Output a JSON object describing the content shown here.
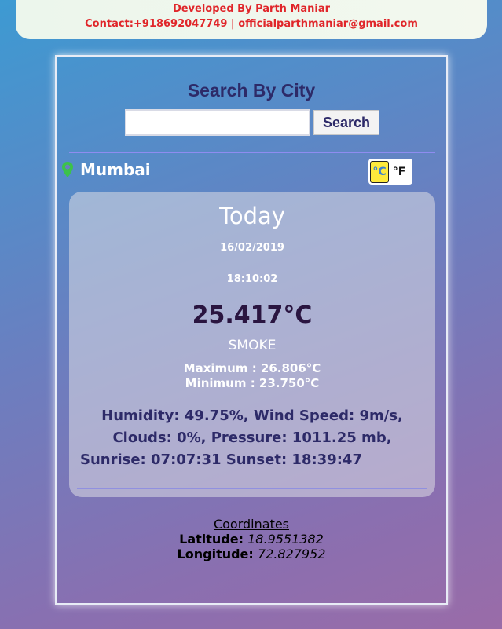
{
  "banner": {
    "developer": "Developed By Parth Maniar",
    "contact": "Contact:+918692047749 | officialparthmaniar@gmail.com"
  },
  "search": {
    "title": "Search By City",
    "input_value": "",
    "button_label": "Search"
  },
  "location": {
    "icon": "map-pin-icon",
    "city": "Mumbai"
  },
  "units": {
    "celsius_label": "°C",
    "fahrenheit_label": "°F",
    "selected": "celsius"
  },
  "weather": {
    "title": "Today",
    "date": "16/02/2019",
    "time": "18:10:02",
    "temperature": "25.417°C",
    "description": "SMOKE",
    "maximum": "Maximum : 26.806°C",
    "minimum": "Minimum : 23.750°C",
    "details_line1": "Humidity: 49.75%, Wind Speed: 9m/s,",
    "details_line2": "Clouds: 0%, Pressure: 1011.25 mb,",
    "details_line3": "Sunrise: 07:07:31 Sunset: 18:39:47"
  },
  "coordinates": {
    "title": "Coordinates",
    "latitude_label": "Latitude:",
    "latitude_value": "18.9551382",
    "longitude_label": "Longitude:",
    "longitude_value": "72.827952"
  },
  "colors": {
    "banner_text": "#e0262a",
    "title_text": "#2d2a68",
    "celsius_active_bg": "#ffea3c",
    "pin_green": "#3cc24a"
  }
}
